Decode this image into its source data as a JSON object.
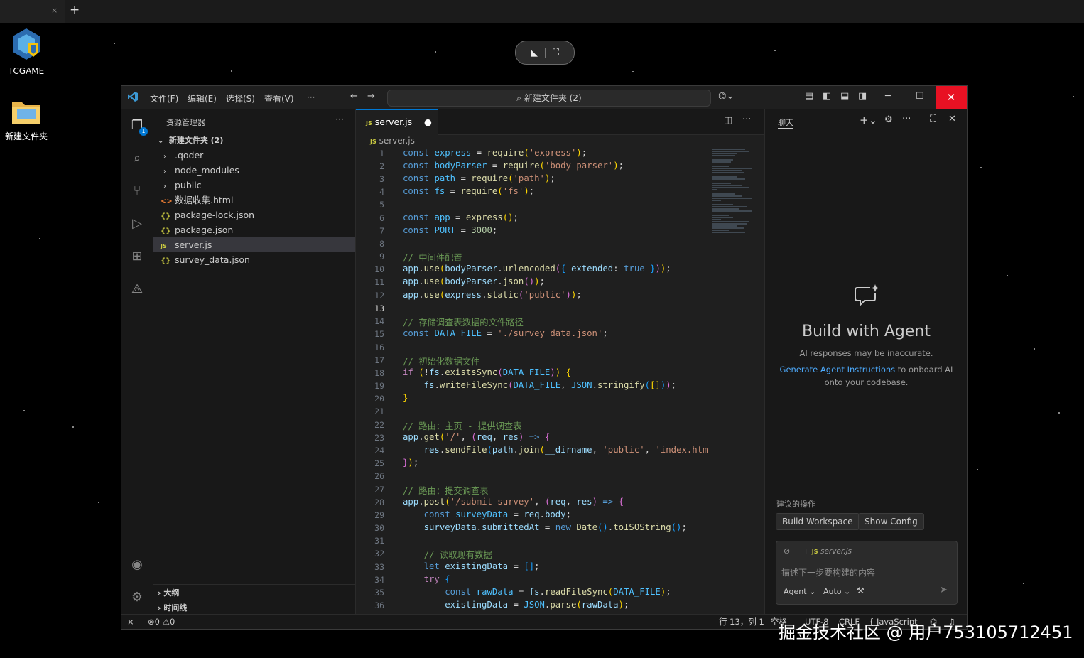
{
  "desktop": {
    "icons": [
      {
        "label": "TCGAME"
      },
      {
        "label": "新建文件夹"
      }
    ]
  },
  "browser": {
    "new_tab": "+",
    "close_tab": "×"
  },
  "window": {
    "menu": [
      "文件(F)",
      "编辑(E)",
      "选择(S)",
      "查看(V)",
      "···"
    ],
    "search_text": "新建文件夹 (2)"
  },
  "explorer": {
    "header": "资源管理器",
    "root": "新建文件夹 (2)",
    "items": [
      {
        "label": ".qoder",
        "type": "folder"
      },
      {
        "label": "node_modules",
        "type": "folder"
      },
      {
        "label": "public",
        "type": "folder"
      },
      {
        "label": "数据收集.html",
        "type": "html",
        "icon": "<>"
      },
      {
        "label": "package-lock.json",
        "type": "json",
        "icon": "{}"
      },
      {
        "label": "package.json",
        "type": "json",
        "icon": "{}"
      },
      {
        "label": "server.js",
        "type": "js",
        "icon": "JS"
      },
      {
        "label": "survey_data.json",
        "type": "json",
        "icon": "{}"
      }
    ],
    "outline": "大纲",
    "timeline": "时间线"
  },
  "editor": {
    "tab_label": "server.js",
    "breadcrumb": "server.js",
    "current_line": 13
  },
  "chat": {
    "title": "聊天",
    "heading": "Build with Agent",
    "subtitle": "AI responses may be inaccurate.",
    "link": "Generate Agent Instructions",
    "link_rest": "to onboard AI onto your codebase.",
    "suggestions_label": "建议的操作",
    "suggestions": [
      "Build Workspace",
      "Show Config"
    ],
    "context_file": "server.js",
    "placeholder": "描述下一步要构建的内容",
    "mode": "Agent",
    "model": "Auto"
  },
  "status": {
    "errors": "0",
    "warnings": "0",
    "position": "行 13，列 1",
    "spaces": "空格",
    "encoding": "UTF-8",
    "eol": "CRLF",
    "language": "JavaScript"
  },
  "watermark": "掘金技术社区 @ 用户753105712451"
}
